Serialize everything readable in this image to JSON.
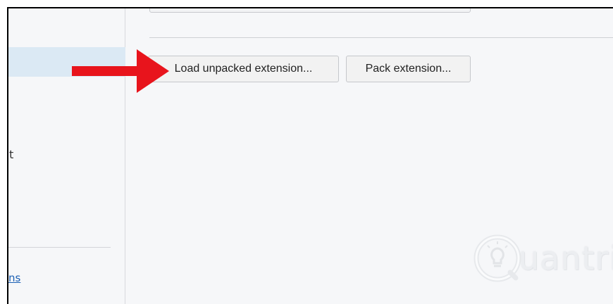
{
  "sidebar": {
    "partial_text": "t",
    "link_fragment": "ns"
  },
  "buttons": {
    "load_unpacked": "Load unpacked extension...",
    "pack": "Pack extension..."
  },
  "watermark": {
    "text": "uantrimang"
  },
  "colors": {
    "arrow": "#e8141c",
    "sidebar_selected": "#dbe9f4",
    "background": "#f6f7f9",
    "link": "#1a5fb4"
  }
}
